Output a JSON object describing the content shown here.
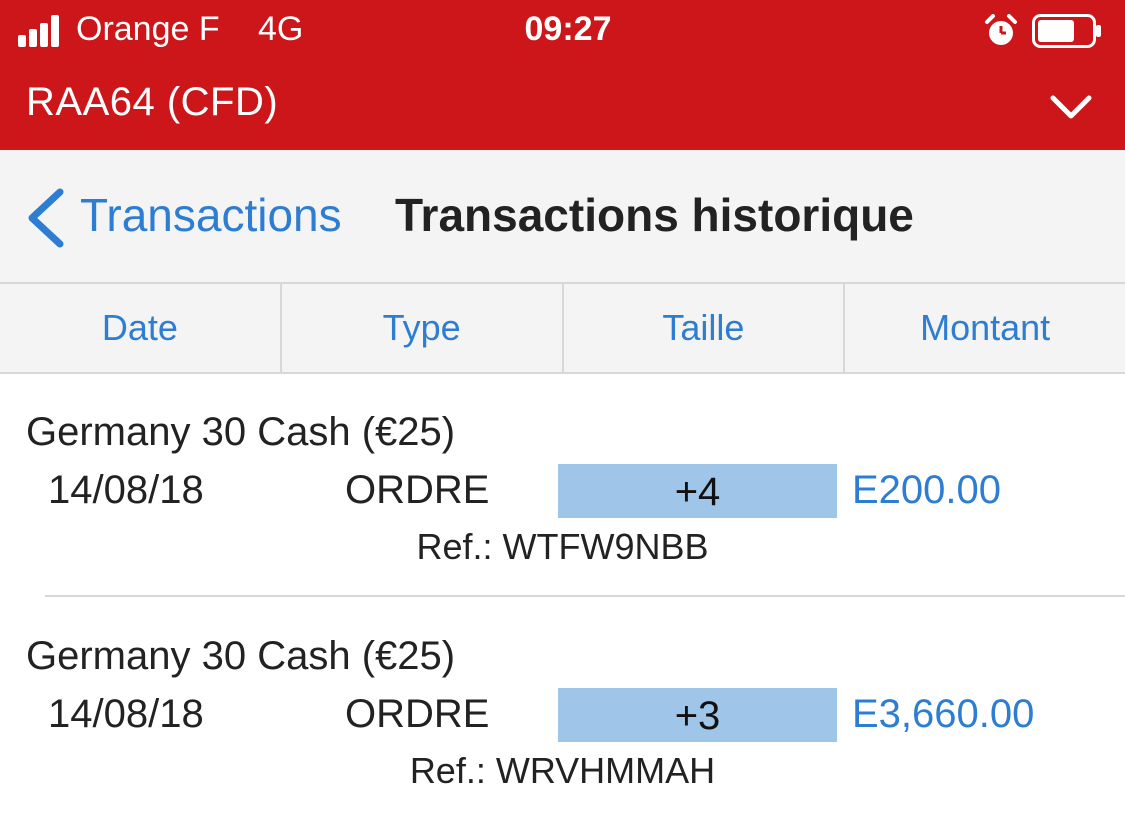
{
  "status_bar": {
    "carrier": "Orange F",
    "network": "4G",
    "time": "09:27",
    "signal_bars": 4,
    "battery_level": 0.7
  },
  "header": {
    "account_title": "RAA64 (CFD)",
    "dropdown_icon": "chevron-down-icon",
    "color": "#cc1619"
  },
  "nav": {
    "back_label": "Transactions",
    "title": "Transactions historique"
  },
  "columns": [
    "Date",
    "Type",
    "Taille",
    "Montant"
  ],
  "transactions": [
    {
      "instrument": "Germany 30 Cash (€25)",
      "date": "14/08/18",
      "type": "ORDRE",
      "size": "+4",
      "amount": "E200.00",
      "ref": "Ref.: WTFW9NBB"
    },
    {
      "instrument": "Germany 30 Cash (€25)",
      "date": "14/08/18",
      "type": "ORDRE",
      "size": "+3",
      "amount": "E3,660.00",
      "ref": "Ref.: WRVHMMAH"
    }
  ],
  "colors": {
    "accent_red": "#cc1619",
    "link_blue": "#2d7dd2",
    "size_highlight": "#9fc5e8"
  }
}
